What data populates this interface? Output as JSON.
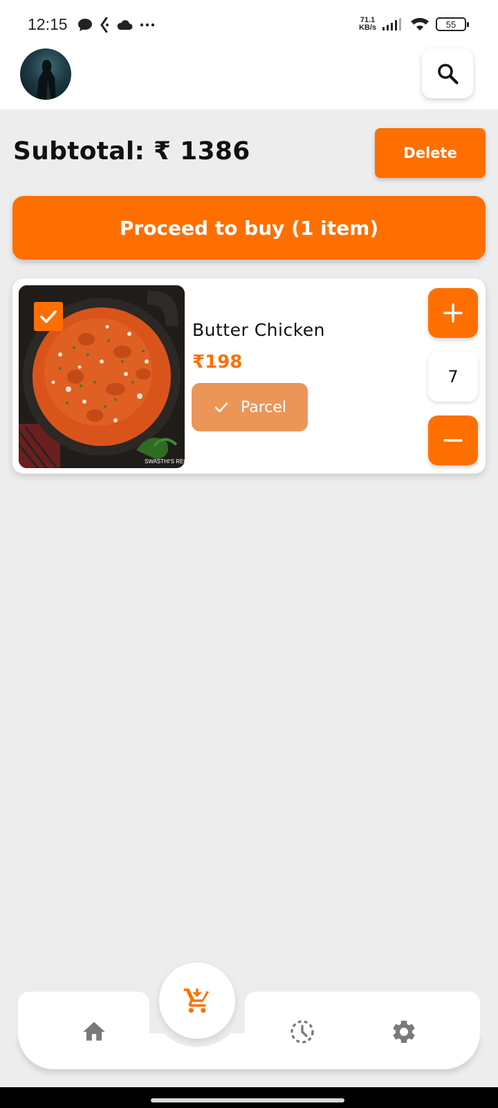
{
  "status_bar": {
    "time": "12:15",
    "net_speed_value": "71.1",
    "net_speed_unit": "KB/s",
    "battery": "55"
  },
  "cart": {
    "subtotal_label": "Subtotal: ₹ 1386",
    "delete_label": "Delete",
    "proceed_label": "Proceed to buy (1 item)",
    "items": [
      {
        "name": "Butter Chicken",
        "price": "₹198",
        "parcel_label": "Parcel",
        "quantity": "7",
        "selected": true,
        "image_watermark": "SWASTHI'S RECI"
      }
    ]
  },
  "colors": {
    "accent": "#ff6f00",
    "parcel": "#ec9559",
    "nav_icon": "#7a7a7a",
    "background": "#ededed"
  },
  "bottom_nav": {
    "items": [
      "home-icon",
      "cart-icon",
      "history-icon",
      "settings-icon"
    ],
    "active": "cart-icon"
  }
}
